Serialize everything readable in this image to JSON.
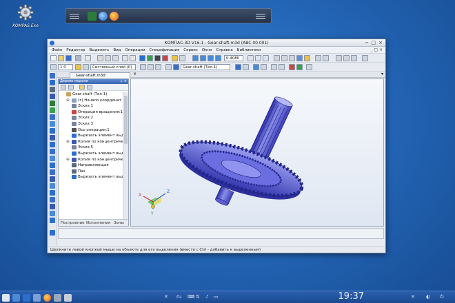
{
  "desktop": {
    "icon_label": "KOMPAS.Exe"
  },
  "window": {
    "title": "КОМПАС-3D V16.1 - Gear-shaft.m3d (ABC 00.001)",
    "controls": [
      "−",
      "□",
      "×"
    ]
  },
  "menu": {
    "items": [
      "Файл",
      "Редактор",
      "Выделить",
      "Вид",
      "Операции",
      "Спецификация",
      "Сервис",
      "Окно",
      "Справка",
      "Библиотеки"
    ]
  },
  "toolbar": {
    "zoom_value": "0.4080",
    "step_value": "1.0",
    "layer_value": "Системный слой (0)",
    "body_value": "Gear-shaft (Тел-1)"
  },
  "doc_tab": {
    "label": "Gear-shaft.m3d"
  },
  "tree": {
    "header": "Дерево модели",
    "items": [
      {
        "label": "Gear-shaft (Тел-1)",
        "indent": 0,
        "icon": "part-icon",
        "color": "#c8a060"
      },
      {
        "label": "(т) Начало координат",
        "indent": 1,
        "icon": "origin-icon",
        "color": "#8aa0c0"
      },
      {
        "label": "Эскиз:1",
        "indent": 1,
        "icon": "sketch-icon",
        "color": "#7a86a0"
      },
      {
        "label": "Операция вращения:1",
        "indent": 1,
        "icon": "revolve-icon",
        "color": "#d04040"
      },
      {
        "label": "Эскиз:2",
        "indent": 1,
        "icon": "sketch-icon",
        "color": "#7a86a0"
      },
      {
        "label": "Эскиз:3",
        "indent": 1,
        "icon": "sketch-icon",
        "color": "#7a86a0"
      },
      {
        "label": "Ось операции:1",
        "indent": 1,
        "icon": "axis-icon",
        "color": "#555"
      },
      {
        "label": "Вырезать элемент выда",
        "indent": 1,
        "icon": "cut-icon",
        "color": "#2a6fd0"
      },
      {
        "label": "Копия по концентричес",
        "indent": 1,
        "icon": "array-icon",
        "color": "#3a5ab0"
      },
      {
        "label": "Эскиз:5",
        "indent": 1,
        "icon": "sketch-icon",
        "color": "#7a86a0"
      },
      {
        "label": "Вырезать элемент выда",
        "indent": 1,
        "icon": "cut-icon",
        "color": "#2a6fd0"
      },
      {
        "label": "Копия по концентричес",
        "indent": 1,
        "icon": "array-icon",
        "color": "#3a5ab0"
      },
      {
        "label": "Направляющая",
        "indent": 1,
        "icon": "guide-icon",
        "color": "#5a6a80"
      },
      {
        "label": "Паз",
        "indent": 1,
        "icon": "slot-icon",
        "color": "#5a6a80"
      },
      {
        "label": "Вырезать элемент выда",
        "indent": 1,
        "icon": "cut-icon",
        "color": "#2a6fd0"
      }
    ],
    "tabs": [
      "Построение",
      "Исполнения",
      "Зоны"
    ]
  },
  "axes": {
    "x": "X",
    "y": "Y",
    "z": "Z"
  },
  "status": {
    "text": "Щелкните левой кнопкой мыши на объекте для его выделения (вместе с Ctrl - добавить к выделенным)"
  },
  "taskbar": {
    "lang": "ru",
    "clock": "19:37"
  }
}
